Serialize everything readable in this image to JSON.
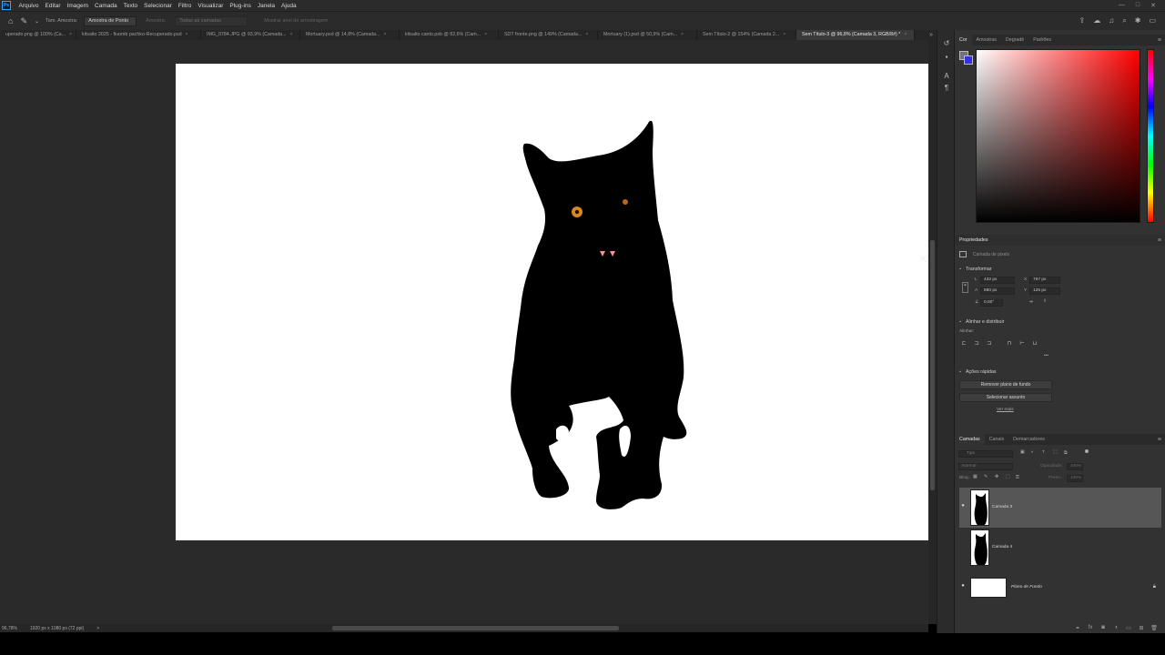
{
  "menubar": {
    "logo": "Ps",
    "items": [
      "Arquivo",
      "Editar",
      "Imagem",
      "Camada",
      "Texto",
      "Selecionar",
      "Filtro",
      "Visualizar",
      "Plug-ins",
      "Janela",
      "Ajuda"
    ],
    "window_controls": [
      "—",
      "□",
      "✕"
    ]
  },
  "options": {
    "sample_size_label": "Tam. Amostra:",
    "sample_size_value": "Amostra de Ponto",
    "sample_label": "Amostra:",
    "sample_value": "Todas as camadas",
    "show_ring": "Mostrar anel de amostragem"
  },
  "tabs": [
    {
      "label": "uperado.png @ 100% (Ca...",
      "active": false
    },
    {
      "label": "kitsalto 2025 - fiuomb pachko-Recuperado.psd",
      "active": false
    },
    {
      "label": "IMG_0784.JPG @ 93,9% (Camada...",
      "active": false
    },
    {
      "label": "Mortuary.psd @ 14,8% (Camada...",
      "active": false
    },
    {
      "label": "kitsalto canto.psb @ 82,6% (Cam...",
      "active": false
    },
    {
      "label": "SDT fronte.png @ 149% (Camada...",
      "active": false
    },
    {
      "label": "Mortuary (1).psd @ 50,9% (Cam...",
      "active": false
    },
    {
      "label": "Sem Título-2 @ 154% (Camada 2...",
      "active": false
    },
    {
      "label": "Sem Título-3 @ 96,8% (Camada 3, RGB/8#) *",
      "active": true
    }
  ],
  "status": {
    "zoom": "96,78%",
    "doc_size": "1920 px x 1080 px (72 ppi)",
    "arrow": ">"
  },
  "color_panel": {
    "tabs": [
      "Cor",
      "Amostras",
      "Degradê",
      "Padrões"
    ],
    "foreground": "#6f6f86",
    "background": "#3434d8"
  },
  "properties": {
    "title": "Propriedades",
    "layer_type": "Camada de pixels",
    "transform_title": "Transformar",
    "w_label": "L",
    "w_value": "432 px",
    "h_label": "A",
    "h_value": "880 px",
    "x_label": "X",
    "x_value": "767 px",
    "y_label": "Y",
    "y_value": "125 px",
    "angle_value": "0,00°",
    "align_title": "Alinhar e distribuir",
    "align_label": "Alinhar:",
    "more": "•••",
    "quick_title": "Ações rápidas",
    "btn_remove_bg": "Remover plano de fundo",
    "btn_select_subject": "Selecionar assunto",
    "see_more": "Ver mais"
  },
  "layers": {
    "tabs": [
      "Camadas",
      "Canais",
      "Demarcadores"
    ],
    "search_placeholder": "Tipo",
    "blend_mode": "Normal",
    "opacity_label": "Opacidade:",
    "opacity_value": "100%",
    "lock_label": "Bloq.:",
    "fill_label": "Preen.:",
    "fill_value": "100%",
    "rows": [
      {
        "name": "Camada 3",
        "visible": true,
        "selected": true
      },
      {
        "name": "Camada 4",
        "visible": false,
        "selected": false
      },
      {
        "name": "Plano de Fundo",
        "visible": true,
        "selected": false
      }
    ]
  }
}
